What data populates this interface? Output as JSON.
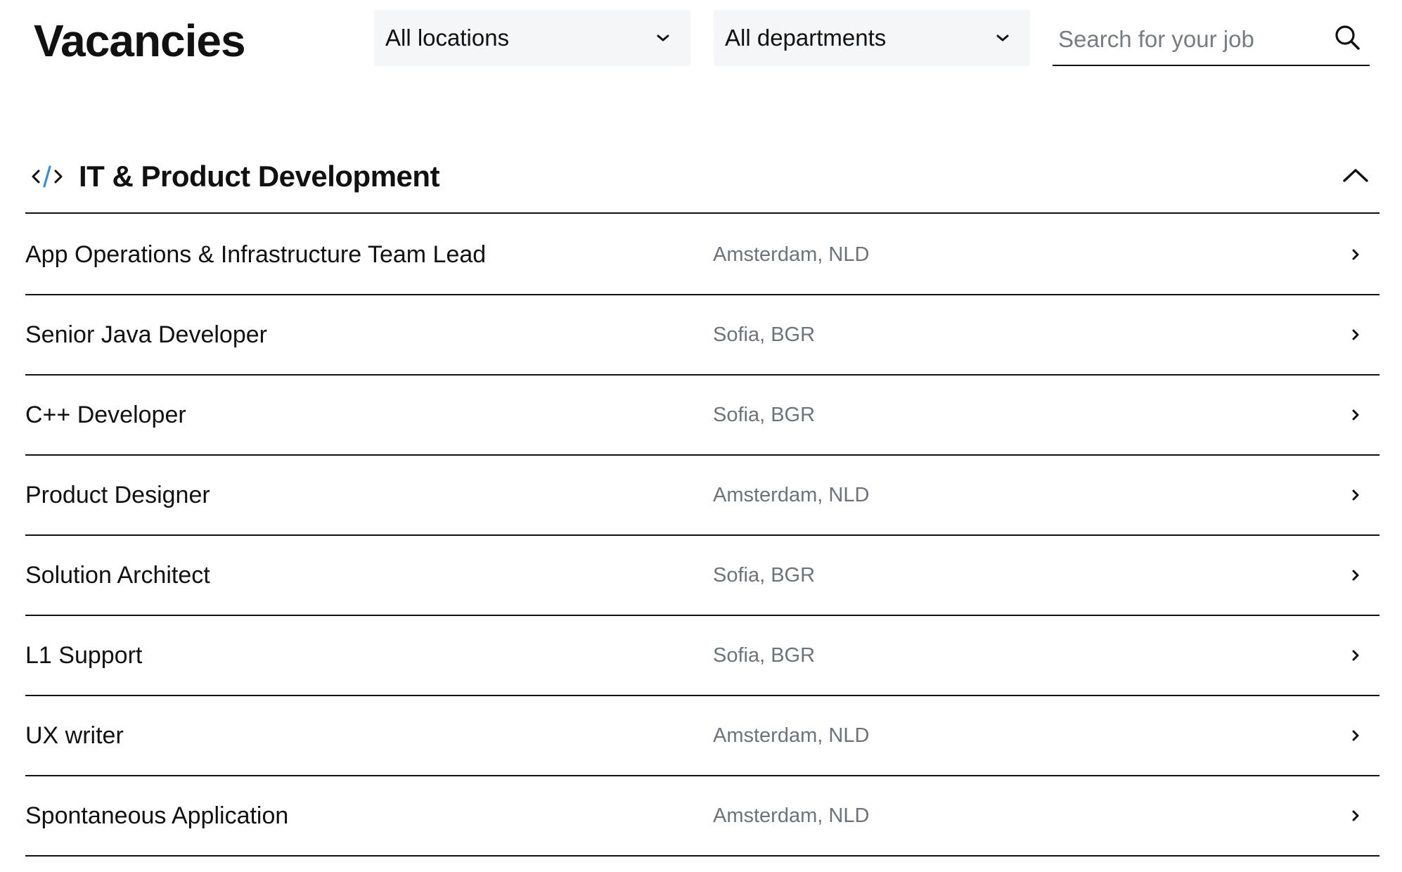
{
  "header": {
    "title": "Vacancies"
  },
  "filters": {
    "location": {
      "selected": "All locations",
      "icon": "chevron-down-icon"
    },
    "department": {
      "selected": "All departments",
      "icon": "chevron-down-icon"
    }
  },
  "search": {
    "placeholder": "Search for your job",
    "value": "",
    "icon": "search-icon"
  },
  "section": {
    "title": "IT & Product Development",
    "icon": "code-icon",
    "toggle_icon": "chevron-up-icon",
    "icon_accent_color": "#3a8fd9",
    "jobs": [
      {
        "title": "App Operations & Infrastructure Team Lead",
        "location": "Amsterdam, NLD"
      },
      {
        "title": "Senior Java Developer",
        "location": "Sofia, BGR"
      },
      {
        "title": "C++ Developer",
        "location": "Sofia, BGR"
      },
      {
        "title": "Product Designer",
        "location": "Amsterdam, NLD"
      },
      {
        "title": "Solution Architect",
        "location": "Sofia, BGR"
      },
      {
        "title": "L1 Support",
        "location": "Sofia, BGR"
      },
      {
        "title": "UX writer",
        "location": "Amsterdam, NLD"
      },
      {
        "title": "Spontaneous Application",
        "location": "Amsterdam, NLD"
      }
    ]
  }
}
